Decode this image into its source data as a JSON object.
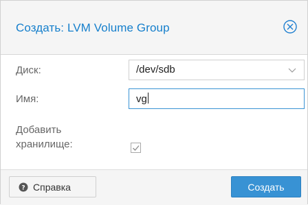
{
  "dialog": {
    "title": "Создать: LVM Volume Group",
    "close_icon": "close-circle-icon"
  },
  "form": {
    "disk": {
      "label": "Диск:",
      "value": "/dev/sdb",
      "icon": "chevron-down-icon"
    },
    "name": {
      "label": "Имя:",
      "value": "vg"
    },
    "add_storage": {
      "label_line1": "Добавить",
      "label_line2": "хранилище:",
      "checked": true
    }
  },
  "footer": {
    "help_label": "Справка",
    "help_icon": "question-circle-icon",
    "create_label": "Создать"
  },
  "colors": {
    "accent": "#157fcc",
    "primary_button": "#3892d4",
    "header_bg": "#f5f5f5"
  }
}
